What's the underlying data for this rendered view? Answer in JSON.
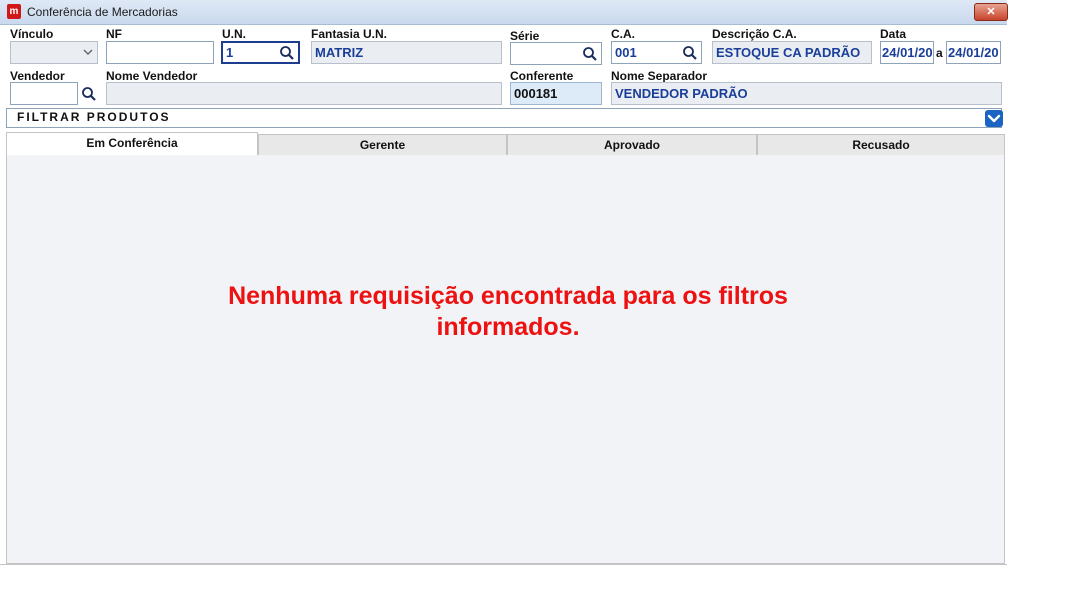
{
  "window": {
    "title": "Conferência de Mercadorias",
    "close_label": "✕"
  },
  "form": {
    "vinculo": {
      "label": "Vínculo",
      "value": ""
    },
    "nf": {
      "label": "NF",
      "value": ""
    },
    "un": {
      "label": "U.N.",
      "value": "1"
    },
    "fantasia_un": {
      "label": "Fantasia U.N.",
      "value": "MATRIZ"
    },
    "serie": {
      "label": "Série",
      "value": ""
    },
    "ca": {
      "label": "C.A.",
      "value": "001"
    },
    "descricao_ca": {
      "label": "Descrição C.A.",
      "value": "ESTOQUE CA PADRÃO"
    },
    "data": {
      "label": "Data",
      "from": "24/01/20",
      "separator": "a",
      "to": "24/01/20"
    },
    "vendedor": {
      "label": "Vendedor",
      "value": ""
    },
    "nome_vendedor": {
      "label": "Nome Vendedor",
      "value": ""
    },
    "conferente": {
      "label": "Conferente",
      "value": "000181"
    },
    "nome_separador": {
      "label": "Nome Separador",
      "value": "VENDEDOR PADRÃO"
    }
  },
  "filter": {
    "label": "FILTRAR PRODUTOS"
  },
  "tabs": [
    {
      "label": "Em Conferência",
      "active": true
    },
    {
      "label": "Gerente",
      "active": false
    },
    {
      "label": "Aprovado",
      "active": false
    },
    {
      "label": "Recusado",
      "active": false
    }
  ],
  "content": {
    "empty_message_line1": "Nenhuma requisição encontrada para os filtros",
    "empty_message_line2": "informados."
  },
  "colors": {
    "accent_text": "#1a3f9a",
    "message": "#ee1111",
    "title_bar": "#c9d9ee"
  },
  "icons": {
    "search": "magnifier-icon",
    "filter_toggle": "chevron-down-icon",
    "close": "close-icon",
    "app": "app-logo-icon"
  }
}
